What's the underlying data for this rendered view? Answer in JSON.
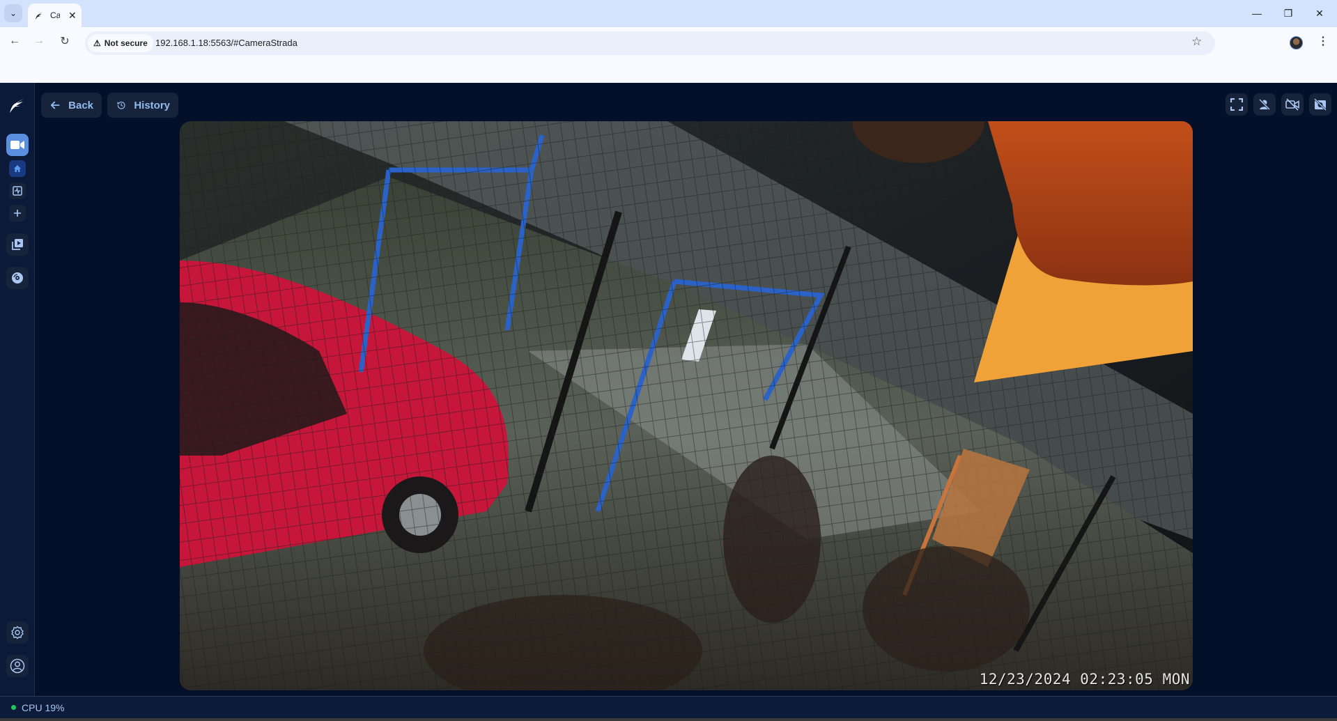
{
  "browser": {
    "tab_title": "Ca",
    "security_label": "Not secure",
    "url": "192.168.1.18:5563/#CameraStrada",
    "icons": {
      "tab_search": "chevron-down-icon",
      "close_tab": "close-icon",
      "back": "arrow-left-icon",
      "forward": "arrow-right-icon",
      "reload": "reload-icon",
      "warning": "warning-triangle-icon",
      "bookmark": "star-icon",
      "menu": "more-vertical-icon",
      "minimize": "minimize-icon",
      "restore": "restore-icon",
      "close": "close-icon"
    }
  },
  "app": {
    "header": {
      "back_label": "Back",
      "history_label": "History"
    },
    "sidebar": {
      "items": [
        {
          "name": "cameras",
          "icon": "video-camera-icon",
          "active": true
        },
        {
          "name": "home",
          "icon": "home-icon",
          "active": true
        },
        {
          "name": "activity",
          "icon": "activity-icon"
        },
        {
          "name": "add",
          "icon": "plus-icon"
        },
        {
          "name": "playback",
          "icon": "video-library-icon"
        },
        {
          "name": "storage",
          "icon": "disc-icon"
        },
        {
          "name": "settings",
          "icon": "gear-icon"
        },
        {
          "name": "account",
          "icon": "user-circle-icon"
        }
      ]
    },
    "toolbar_icons": [
      "fullscreen-icon",
      "person-off-icon",
      "video-off-icon",
      "snapshot-off-icon"
    ],
    "camera": {
      "name": "CameraStrada",
      "osd_timestamp": "12/23/2024 02:23:05 MON"
    },
    "status": {
      "cpu_label": "CPU 19%",
      "status_color": "#21c55d"
    }
  }
}
